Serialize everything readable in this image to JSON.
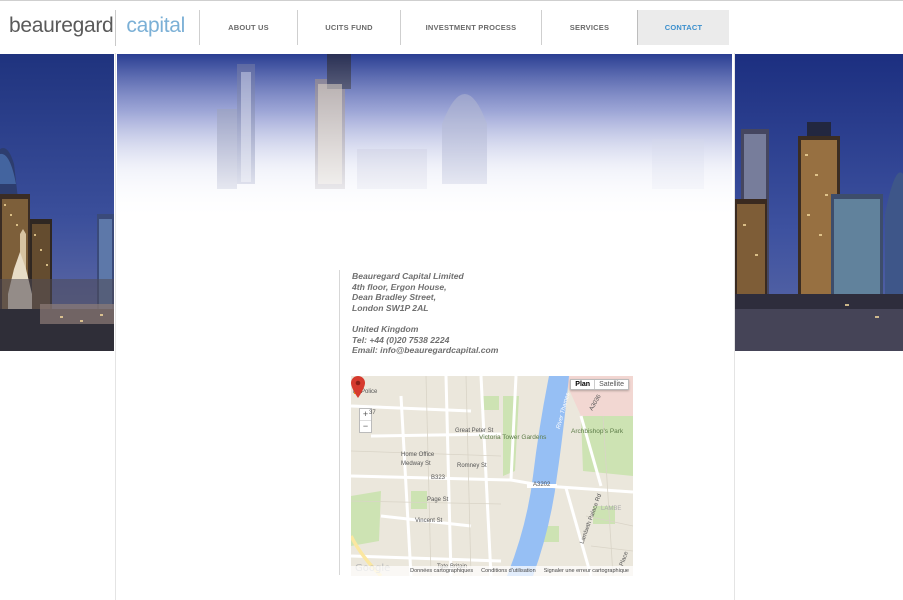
{
  "logo": {
    "word1": "beauregard",
    "word2": "capital"
  },
  "nav": {
    "items": [
      {
        "label": "ABOUT US",
        "active": false
      },
      {
        "label": "UCITS FUND",
        "active": false
      },
      {
        "label": "INVESTMENT PROCESS",
        "active": false
      },
      {
        "label": "SERVICES",
        "active": false
      },
      {
        "label": "CONTACT",
        "active": true
      }
    ]
  },
  "contact": {
    "company": "Beauregard Capital Limited",
    "line1": "4th floor, Ergon House,",
    "line2": "Dean Bradley Street,",
    "line3": "London SW1P 2AL",
    "country": "United Kingdom",
    "tel": "Tel: +44 (0)20 7538 2224",
    "email": "Email: info@beauregardcapital.com"
  },
  "map": {
    "toggle": {
      "plan": "Plan",
      "satellite": "Satellite"
    },
    "zoom": {
      "plus": "+",
      "minus": "−"
    },
    "labels": {
      "police": "ns Police",
      "a37": "37",
      "great_peter": "Great Peter St",
      "victoria_tower": "Victoria Tower Gardens",
      "home_office": "Home Office",
      "medway": "Medway St",
      "romney": "Romney St",
      "b323": "B323",
      "a3202": "A3202",
      "page_st": "Page St",
      "vincent_st": "Vincent St",
      "river": "River Thames",
      "archbishop": "Archbishop's Park",
      "a3036": "A3036",
      "lambeth": "LAMBE",
      "lambeth_palace": "Lambeth Palace Rd",
      "tate": "Tate Britain",
      "place": "Place"
    },
    "footer": {
      "data": "Données cartographiques",
      "terms": "Conditions d'utilisation",
      "report": "Signaler une erreur cartographique"
    },
    "brand": "Google"
  },
  "colors": {
    "accent": "#3b8fcd",
    "logo_grey": "#5a5a5a",
    "logo_blue": "#7bb0d6",
    "sky_top": "#223a86",
    "river": "#96bff4",
    "park": "#cde3b3",
    "pin": "#d63a2e"
  }
}
